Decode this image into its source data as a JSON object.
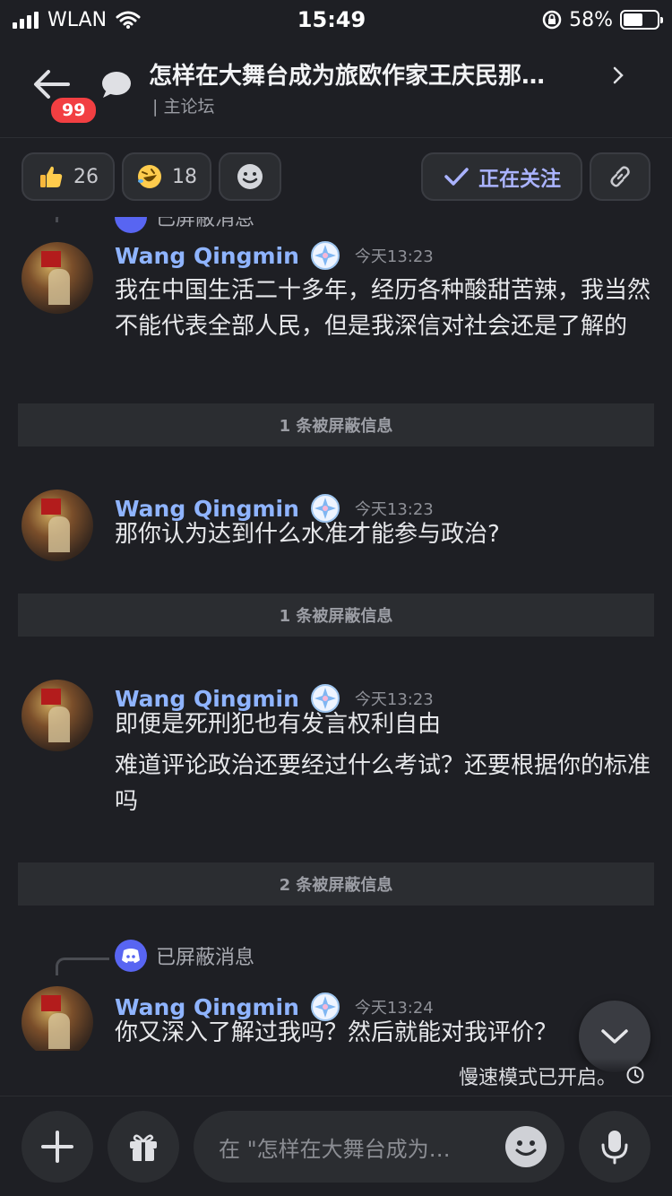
{
  "status_bar": {
    "carrier": "WLAN",
    "time": "15:49",
    "battery_percent": "58%",
    "battery_level": 0.58
  },
  "header": {
    "back_badge": "99",
    "title": "怎样在大舞台成为旅欧作家王庆民那…",
    "subtitle": "| 主论坛"
  },
  "reactions": [
    {
      "icon": "thumbs-up-emoji",
      "count": "26"
    },
    {
      "icon": "rofl-emoji",
      "count": "18"
    }
  ],
  "follow_label": "正在关注",
  "messages": [
    {
      "username": "Wang Qingmin",
      "time": "今天13:23",
      "lines": [
        "我在中国生活二十多年，经历各种酸甜苦辣，我当然不能代表全部人民，但是我深信对社会还是了解的"
      ]
    },
    {
      "username": "Wang Qingmin",
      "time": "今天13:23",
      "lines": [
        "那你认为达到什么水准才能参与政治?"
      ]
    },
    {
      "username": "Wang Qingmin",
      "time": "今天13:23",
      "lines": [
        "即便是死刑犯也有发言权利自由",
        "难道评论政治还要经过什么考试？还要根据你的标准吗"
      ]
    },
    {
      "username": "Wang Qingmin",
      "time": "今天13:24",
      "lines": [
        "你又深入了解过我吗？然后就能对我评价？"
      ]
    }
  ],
  "blocked_bars": [
    "1 条被屏蔽信息",
    "1 条被屏蔽信息",
    "2 条被屏蔽信息"
  ],
  "reply_blocked_label": "已屏蔽消息",
  "slowmode_text": "慢速模式已开启。",
  "composer": {
    "placeholder": "在 \"怎样在大舞台成为…"
  },
  "colors": {
    "background": "#1e1f24",
    "surface": "#2b2d31",
    "username": "#8fb4ff",
    "accent": "#5865f2",
    "badge": "#f23f42"
  }
}
